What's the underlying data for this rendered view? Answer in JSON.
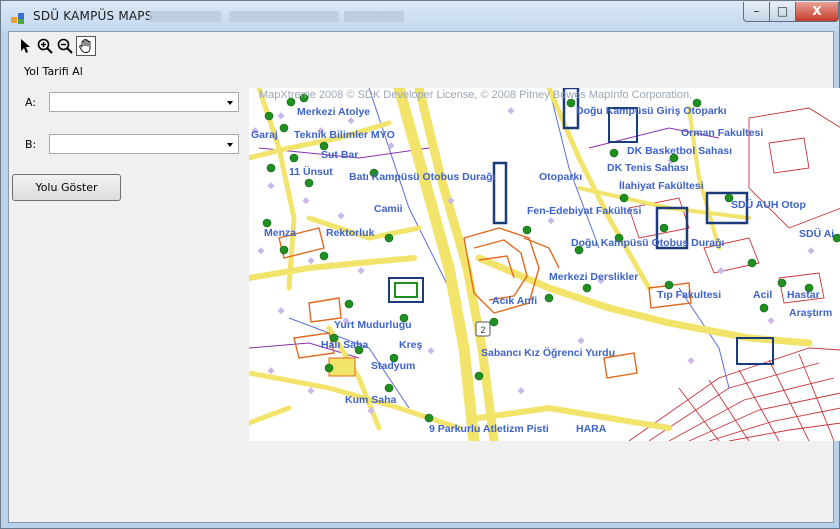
{
  "window": {
    "title": "SDÜ KAMPÜS MAPS",
    "controls": {
      "minimize": "–",
      "maximize": "□",
      "close": "X"
    }
  },
  "toolbar": {
    "tools": [
      "pointer-icon",
      "zoom-in-icon",
      "zoom-out-icon",
      "pan-hand-icon"
    ],
    "selected": "pan-hand-icon"
  },
  "route": {
    "heading": "Yol Tarifi Al",
    "from_label": "A:",
    "to_label": "B:",
    "from_value": "",
    "to_value": "",
    "button_label": "Yolu Göster"
  },
  "map": {
    "copyright": "MapXtreme 2008 © SDK Developer License, © 2008 Pitney Bowes MapInfo Corporation.",
    "labels": [
      "Merkezi Atolye",
      "Garaj",
      "Teknik Bilimler MYO",
      "Sut Bar",
      "11 Ünsut",
      "Batı Kampüsü Otobus Durağı",
      "Otoparkı",
      "Camii",
      "Menza",
      "Rektorluk",
      "Doğu Kampüsü Giriş Otoparkı",
      "Orman Fakultesi",
      "DK Basketbol Sahası",
      "DK Tenis Sahası",
      "İlahiyat Fakültesi",
      "Fen-Edebiyat Fakültesi",
      "SDÜ AUH Otop",
      "SDÜ Ai",
      "Doğu Kampüsü Otobus Durağı",
      "Merkezi Derslikler",
      "Acık Anfi",
      "Tıp Fakultesi",
      "Acil",
      "Hastar",
      "Araştırm",
      "Yurt Mudurlugu",
      "Halı Saha",
      "Kreş",
      "Stadyum",
      "Sabancı Kız Öğrenci Yurdu",
      "Kum Saha",
      "9 Parkurlu Atletizm Pisti",
      "HARA"
    ],
    "road_badge": "2",
    "colors": {
      "road": "#f2e36b",
      "building": "#e06a1f",
      "marker": "#1f8f1f",
      "node": "#c9b8e8",
      "label": "#3f63c7",
      "parcel": "#c9363a"
    }
  }
}
